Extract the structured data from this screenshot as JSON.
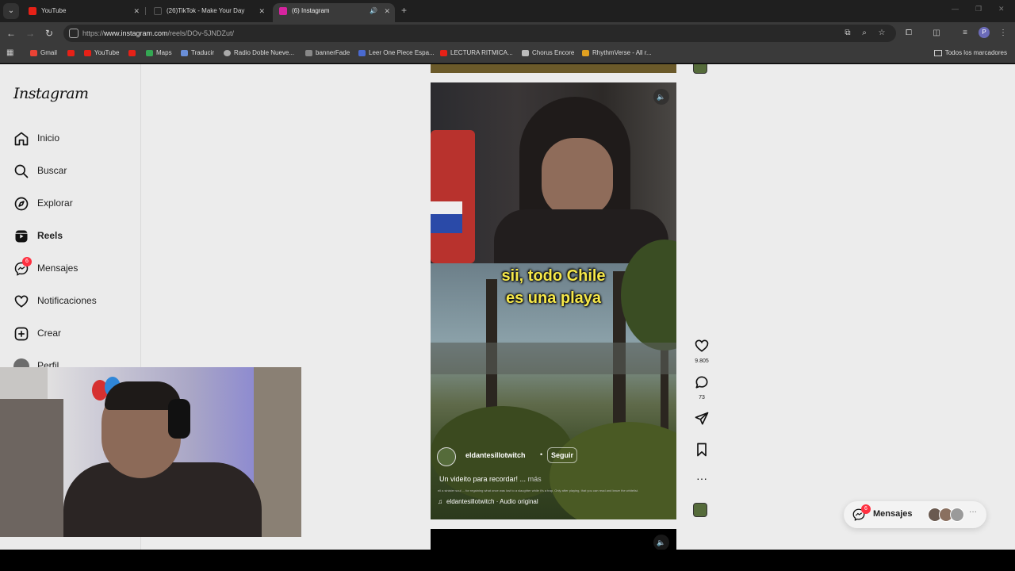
{
  "browser": {
    "tabs": [
      {
        "title": "YouTube",
        "active": false
      },
      {
        "title": "(26)TikTok - Make Your Day",
        "active": false
      },
      {
        "title": "(6) Instagram",
        "active": true
      }
    ],
    "url": {
      "scheme": "https://",
      "host": "www.instagram.com",
      "path": "/reels/DOv-5JNDZut/"
    },
    "bookmarks": [
      {
        "label": "Gmail",
        "icon_color": "#ea4335"
      },
      {
        "label": "",
        "icon_color": "#e62117"
      },
      {
        "label": "YouTube",
        "icon_color": "#e62117"
      },
      {
        "label": "",
        "icon_color": "#e62117"
      },
      {
        "label": "Maps",
        "icon_color": "#34a853"
      },
      {
        "label": "Traducir",
        "icon_color": "#6a8fd8"
      },
      {
        "label": "Radio Doble Nueve...",
        "icon_color": "#aaaaaa"
      },
      {
        "label": "bannerFade",
        "icon_color": "#888888"
      },
      {
        "label": "Leer One Piece Espa...",
        "icon_color": "#4a6ad0"
      },
      {
        "label": "LECTURA RITMICA...",
        "icon_color": "#e62117"
      },
      {
        "label": "Chorus Encore",
        "icon_color": "#bbbbbb"
      },
      {
        "label": "RhythmVerse - All r...",
        "icon_color": "#e0a020"
      }
    ],
    "all_bookmarks": "Todos los marcadores",
    "profile_initial": "P"
  },
  "sidebar": {
    "logo": "Instagram",
    "items": [
      {
        "label": "Inicio",
        "icon": "home-icon"
      },
      {
        "label": "Buscar",
        "icon": "search-icon"
      },
      {
        "label": "Explorar",
        "icon": "compass-icon"
      },
      {
        "label": "Reels",
        "icon": "reels-icon",
        "selected": true
      },
      {
        "label": "Mensajes",
        "icon": "messenger-icon",
        "badge": "6"
      },
      {
        "label": "Notificaciones",
        "icon": "heart-icon"
      },
      {
        "label": "Crear",
        "icon": "plus-square-icon"
      },
      {
        "label": "Perfil",
        "icon": "avatar-icon"
      }
    ]
  },
  "reel": {
    "caption_line1": "sii, todo Chile",
    "caption_line2": "es una playa",
    "author": "eldantesillotwitch",
    "separator": "•",
    "follow_label": "Seguir",
    "description": "Un videito para recordar! ...",
    "more_label": "más",
    "subtext": "ell a sinister soul ... for regaining what once was lost to a slaughter while it's a trap. Only after playing, that you can read and leave the whitelist.",
    "audio": "eldantesillotwitch · Audio original"
  },
  "actions": {
    "likes": "9.805",
    "comments": "73"
  },
  "messages_pill": {
    "label": "Mensajes",
    "badge": "6"
  },
  "colors": {
    "caption": "#f6e84a",
    "badge": "#ff3040",
    "page_bg": "#ececec"
  }
}
